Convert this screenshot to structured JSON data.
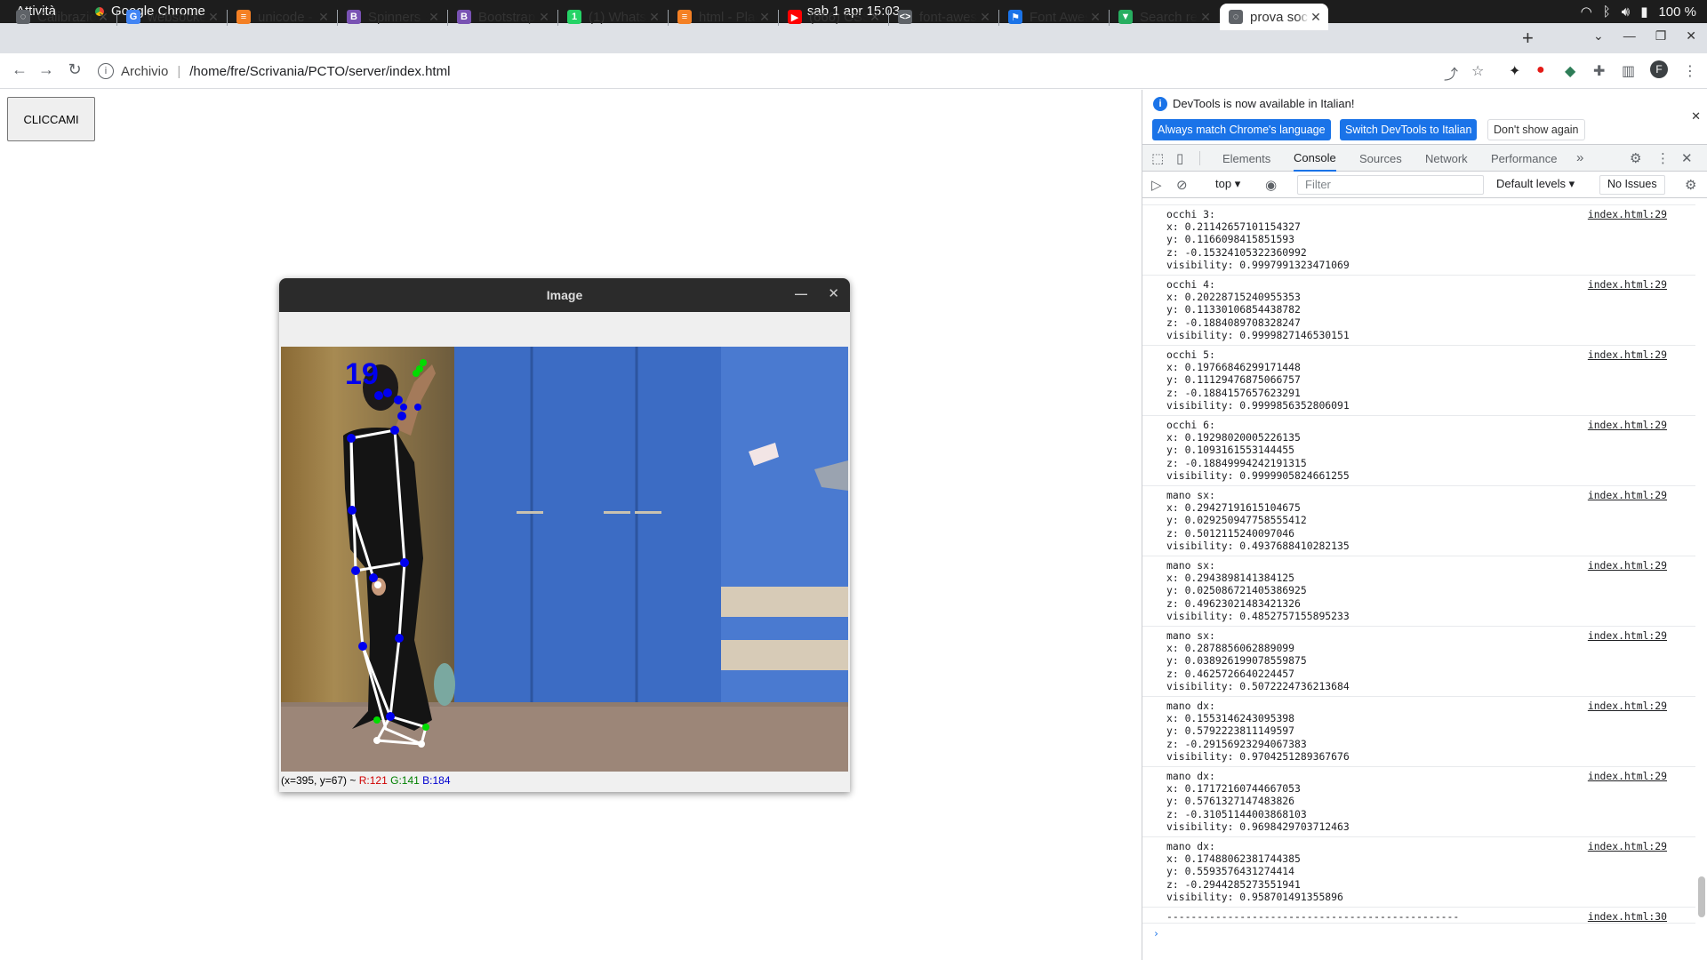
{
  "system": {
    "activities": "Attività",
    "app": "Google Chrome",
    "clock": "sab 1 apr  15:03",
    "battery": "100 %"
  },
  "tabs": [
    {
      "title": "Calibrazion",
      "color": "#5f6368",
      "glyph": "◌"
    },
    {
      "title": "websocket",
      "color": "#4285f4",
      "glyph": "G"
    },
    {
      "title": "unicode - D",
      "color": "#f48024",
      "glyph": "≡"
    },
    {
      "title": "Spinners · B",
      "color": "#7952b3",
      "glyph": "B"
    },
    {
      "title": "Bootstrap",
      "color": "#7952b3",
      "glyph": "B"
    },
    {
      "title": "(1) WhatsA",
      "color": "#25d366",
      "glyph": "1"
    },
    {
      "title": "html - Placi",
      "color": "#f48024",
      "glyph": "≡"
    },
    {
      "title": "(666) CSS 3",
      "color": "#ff0000",
      "glyph": "▶"
    },
    {
      "title": "font-aweso",
      "color": "#5f6368",
      "glyph": "<>"
    },
    {
      "title": "Font Aweso",
      "color": "#1a73e8",
      "glyph": "⚑"
    },
    {
      "title": "Search resu",
      "color": "#27ae60",
      "glyph": "▼"
    },
    {
      "title": "prova sock",
      "color": "#5f6368",
      "glyph": "◌",
      "active": true
    }
  ],
  "address": {
    "protocol": "Archivio",
    "url": "/home/fre/Scrivania/PCTO/server/index.html"
  },
  "page": {
    "button_label": "CLICCAMI"
  },
  "image_window": {
    "title": "Image",
    "status_coords": "(x=395, y=67) ~",
    "status_r": "R:121",
    "status_g": "G:141",
    "status_b": "B:184",
    "overlay_number": "19"
  },
  "devtools": {
    "banner_message": "DevTools is now available in Italian!",
    "btn_match": "Always match Chrome's language",
    "btn_switch": "Switch DevTools to Italian",
    "btn_dont": "Don't show again",
    "tabs": [
      "Elements",
      "Console",
      "Sources",
      "Network",
      "Performance"
    ],
    "active_tab": "Console",
    "context": "top",
    "filter_placeholder": "Filter",
    "levels": "Default levels",
    "issues": "No Issues",
    "log_separator": "------------------------------------------------",
    "log_separator_src": "index.html:30"
  },
  "console_entries": [
    {
      "label": "occhi 3:",
      "x": "0.21142657101154327",
      "y": "0.1166098415851593",
      "z": "-0.15324105322360992",
      "visibility": "0.9997991323471069",
      "src": "index.html:29"
    },
    {
      "label": "occhi 4:",
      "x": "0.20228715240955353",
      "y": "0.11330106854438782",
      "z": "-0.1884089708328247",
      "visibility": "0.9999827146530151",
      "src": "index.html:29"
    },
    {
      "label": "occhi 5:",
      "x": "0.19766846299171448",
      "y": "0.11129476875066757",
      "z": "-0.1884157657623291",
      "visibility": "0.9999856352806091",
      "src": "index.html:29"
    },
    {
      "label": "occhi 6:",
      "x": "0.19298020005226135",
      "y": "0.1093161553144455",
      "z": "-0.18849994242191315",
      "visibility": "0.9999905824661255",
      "src": "index.html:29"
    },
    {
      "label": "mano sx:",
      "x": "0.29427191615104675",
      "y": "0.029250947758555412",
      "z": "0.5012115240097046",
      "visibility": "0.4937688410282135",
      "src": "index.html:29"
    },
    {
      "label": "mano sx:",
      "x": "0.2943898141384125",
      "y": "0.025086721405386925",
      "z": "0.49623021483421326",
      "visibility": "0.4852757155895233",
      "src": "index.html:29"
    },
    {
      "label": "mano sx:",
      "x": "0.2878856062889099",
      "y": "0.038926199078559875",
      "z": "0.4625726640224457",
      "visibility": "0.5072224736213684",
      "src": "index.html:29"
    },
    {
      "label": "mano dx:",
      "x": "0.1553146243095398",
      "y": "0.5792223811149597",
      "z": "-0.29156923294067383",
      "visibility": "0.9704251289367676",
      "src": "index.html:29"
    },
    {
      "label": "mano dx:",
      "x": "0.17172160744667053",
      "y": "0.5761327147483826",
      "z": "-0.31051144003868103",
      "visibility": "0.9698429703712463",
      "src": "index.html:29"
    },
    {
      "label": "mano dx:",
      "x": "0.17488062381744385",
      "y": "0.5593576431274414",
      "z": "-0.2944285273551941",
      "visibility": "0.958701491355896",
      "src": "index.html:29"
    }
  ]
}
